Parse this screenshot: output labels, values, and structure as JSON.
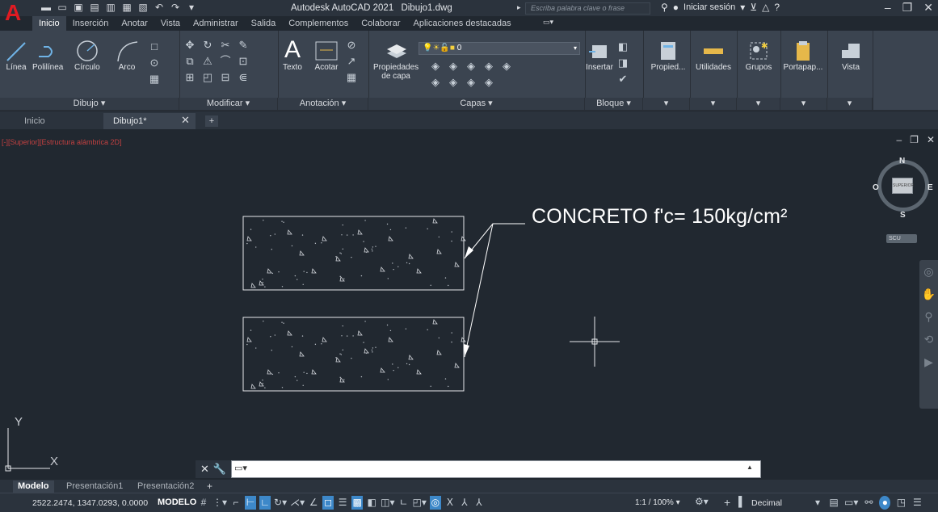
{
  "window": {
    "app_name": "Autodesk AutoCAD 2021",
    "document": "Dibujo1.dwg",
    "search_placeholder": "Escriba palabra clave o frase",
    "signin": "Iniciar sesión"
  },
  "ribbon": {
    "tabs": [
      "Inicio",
      "Inserción",
      "Anotar",
      "Vista",
      "Administrar",
      "Salida",
      "Complementos",
      "Colaborar",
      "Aplicaciones destacadas"
    ],
    "tools": {
      "linea": "Línea",
      "polilinea": "Polilínea",
      "circulo": "Círculo",
      "arco": "Arco",
      "texto": "Texto",
      "acotar": "Acotar",
      "propiedades_capa_1": "Propiedades",
      "propiedades_capa_2": "de capa",
      "insertar": "Insertar",
      "propied": "Propied...",
      "utilidades": "Utilidades",
      "grupos": "Grupos",
      "portapap": "Portapap...",
      "vista": "Vista"
    },
    "layer_value": "0",
    "panels": {
      "dibujo": "Dibujo ▾",
      "modificar": "Modificar ▾",
      "anotacion": "Anotación ▾",
      "capas": "Capas ▾",
      "bloque": "Bloque ▾",
      "arrow": "▾"
    }
  },
  "file_tabs": {
    "inicio": "Inicio",
    "active": "Dibujo1*",
    "close": "✕",
    "add": "+"
  },
  "viewport": {
    "label": "[-][Superior][Estructura alámbrica 2D]",
    "annotation": "CONCRETO f'c= 150kg/cm²",
    "ucs_x": "X",
    "ucs_y": "Y",
    "viewcube": {
      "n": "N",
      "s": "S",
      "e": "E",
      "w": "O",
      "face": "SUPERIOR",
      "ucs": "SCU"
    }
  },
  "layout_tabs": [
    "Modelo",
    "Presentación1",
    "Presentación2"
  ],
  "status": {
    "coords": "2522.2474, 1347.0293, 0.0000",
    "mode": "MODELO",
    "scale": "1:1 / 100% ▾",
    "units": "Decimal"
  },
  "colors": {
    "canvas": "#212830",
    "ribbon": "#3b4450",
    "accent": "#3d88c9",
    "logo": "#e11b22"
  }
}
